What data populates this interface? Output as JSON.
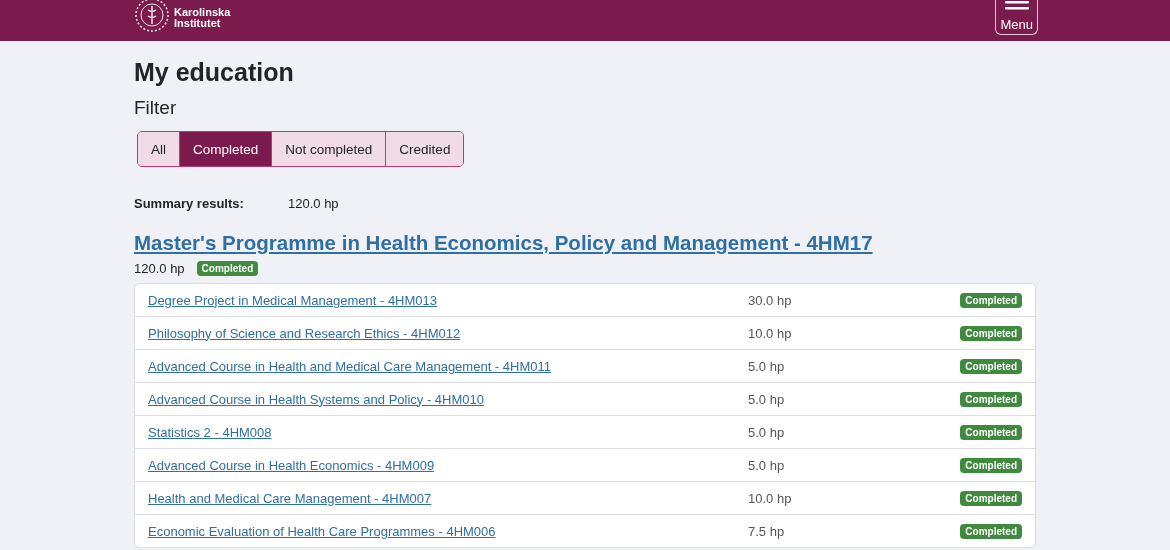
{
  "header": {
    "logo_text": [
      "Karolinska",
      "Institutet"
    ],
    "menu_label": "Menu"
  },
  "title": "My education",
  "filter": {
    "label": "Filter",
    "options": [
      {
        "label": "All",
        "selected": false
      },
      {
        "label": "Completed",
        "selected": true
      },
      {
        "label": "Not completed",
        "selected": false
      },
      {
        "label": "Credited",
        "selected": false
      }
    ]
  },
  "summary": {
    "label": "Summary results:",
    "value": "120.0 hp"
  },
  "programme": {
    "title": "Master's Programme in Health Economics, Policy and Management - 4HM17",
    "credits": "120.0 hp",
    "status": {
      "label": "Completed",
      "kind": "completed"
    },
    "courses": [
      {
        "name": "Degree Project in Medical Management - 4HM013",
        "credits": "30.0 hp",
        "status": {
          "label": "Completed",
          "kind": "completed"
        }
      },
      {
        "name": "Philosophy of Science and Research Ethics - 4HM012",
        "credits": "10.0 hp",
        "status": {
          "label": "Completed",
          "kind": "completed"
        }
      },
      {
        "name": "Advanced Course in Health and Medical Care Management - 4HM011",
        "credits": "5.0 hp",
        "status": {
          "label": "Completed",
          "kind": "completed"
        }
      },
      {
        "name": "Advanced Course in Health Systems and Policy - 4HM010",
        "credits": "5.0 hp",
        "status": {
          "label": "Completed",
          "kind": "completed"
        }
      },
      {
        "name": "Statistics 2 - 4HM008",
        "credits": "5.0 hp",
        "status": {
          "label": "Completed",
          "kind": "completed"
        }
      },
      {
        "name": "Advanced Course in Health Economics - 4HM009",
        "credits": "5.0 hp",
        "status": {
          "label": "Completed",
          "kind": "completed"
        }
      },
      {
        "name": "Health and Medical Care Management - 4HM007",
        "credits": "10.0 hp",
        "status": {
          "label": "Completed",
          "kind": "completed"
        }
      },
      {
        "name": "Economic Evaluation of Health Care Programmes - 4HM006",
        "credits": "7.5 hp",
        "status": {
          "label": "Completed",
          "kind": "completed"
        }
      }
    ]
  }
}
